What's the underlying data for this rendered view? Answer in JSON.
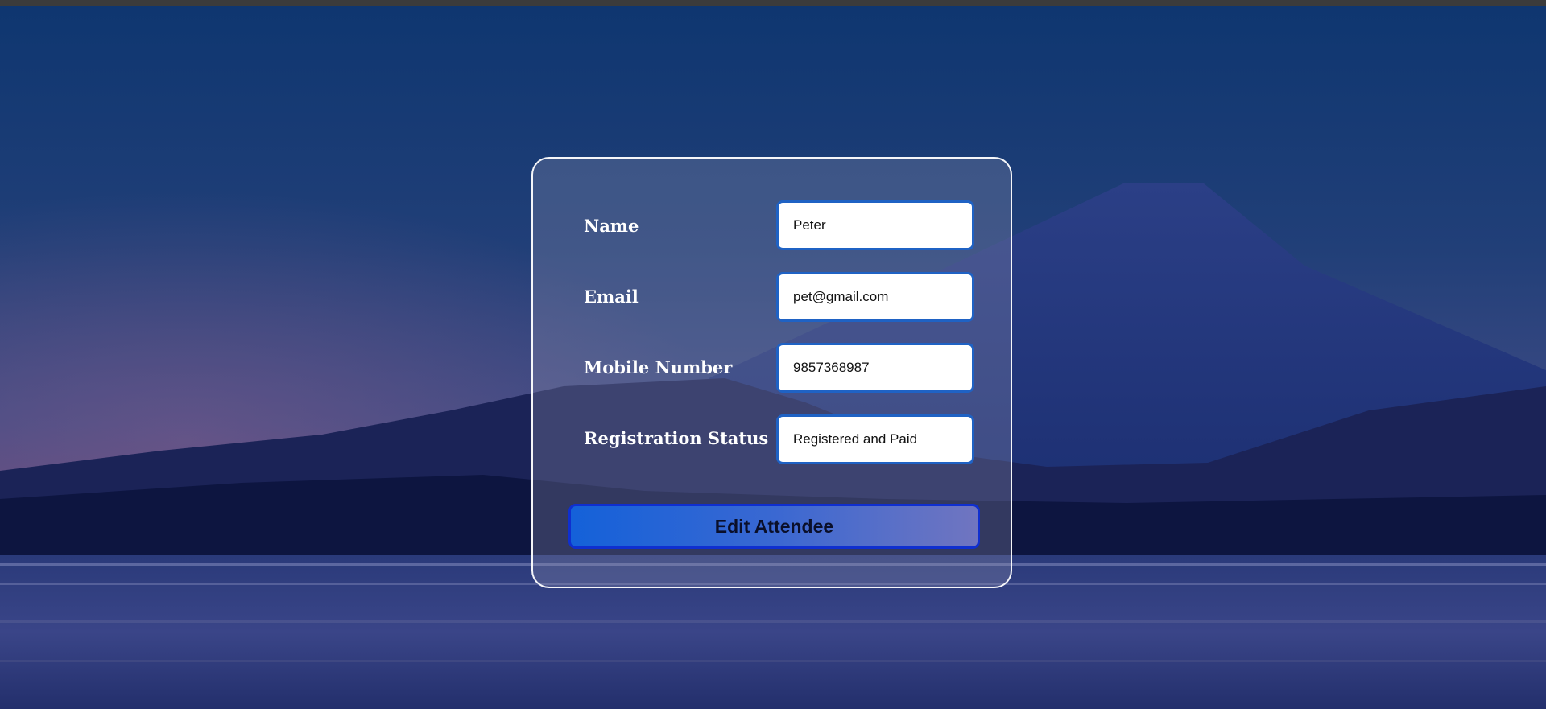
{
  "form": {
    "fields": [
      {
        "label": "Name",
        "value": "Peter"
      },
      {
        "label": "Email",
        "value": "pet@gmail.com"
      },
      {
        "label": "Mobile Number",
        "value": "9857368987"
      },
      {
        "label": "Registration Status",
        "value": "Registered and Paid"
      }
    ],
    "submit_label": "Edit Attendee"
  },
  "colors": {
    "input_border": "#1f62c4",
    "button_gradient_start": "#1461d9",
    "button_gradient_end": "#7075c0",
    "button_border": "#0f2fd0"
  }
}
